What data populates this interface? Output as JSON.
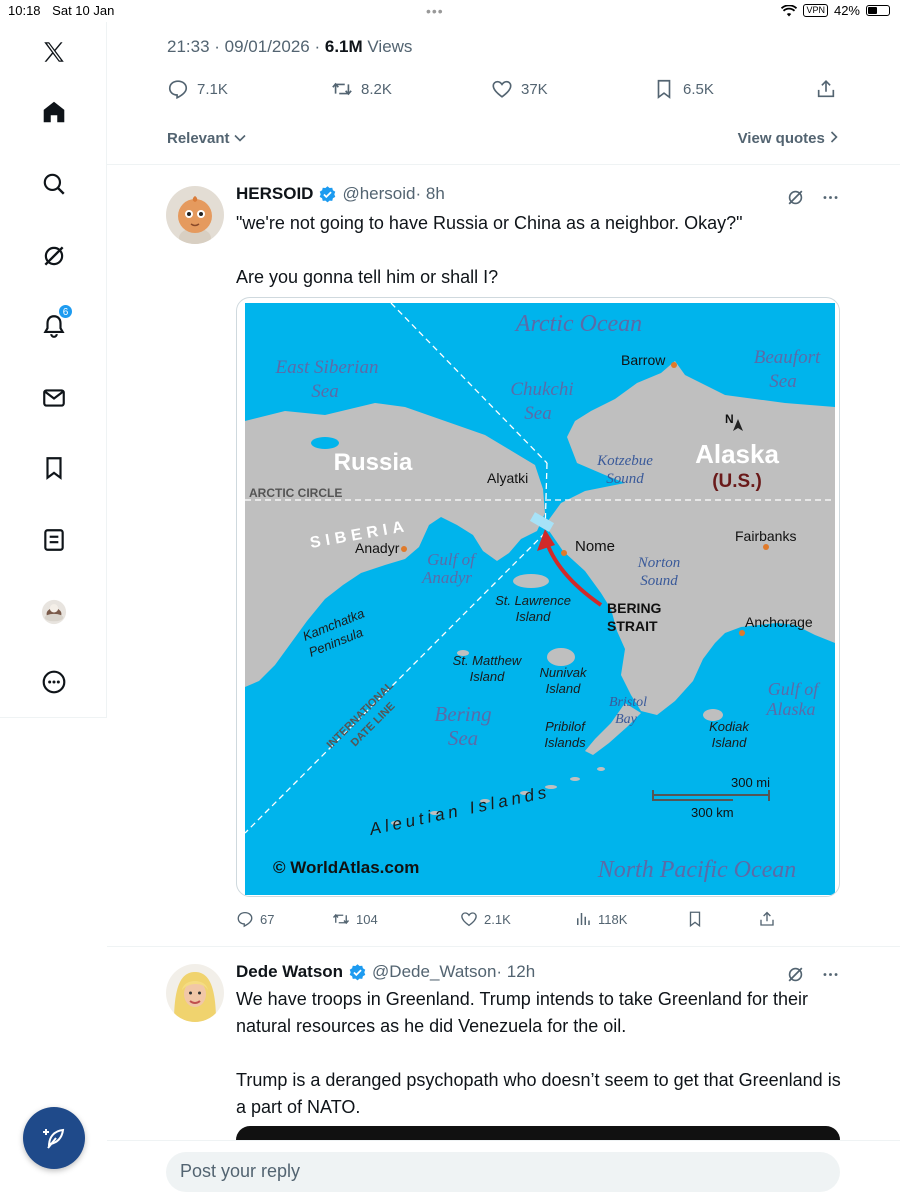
{
  "status_bar": {
    "time": "10:18",
    "date": "Sat 10 Jan",
    "vpn": "VPN",
    "battery": "42%"
  },
  "nav": {
    "notifications_badge": "6"
  },
  "post": {
    "time": "21:33 · 09/01/2026 ·",
    "views_count": "6.1M",
    "views_label": "Views",
    "replies": "7.1K",
    "reposts": "8.2K",
    "likes": "37K",
    "bookmarks": "6.5K"
  },
  "sort": {
    "relevant": "Relevant",
    "view_quotes": "View quotes"
  },
  "reply1": {
    "name": "HERSOID",
    "handle": "@hersoid",
    "age": "· 8h",
    "text1": "\"we're not going to have Russia or China as a neighbor. Okay?\"",
    "text2": "Are you gonna tell him or shall I?",
    "replies": "67",
    "reposts": "104",
    "likes": "2.1K",
    "views": "118K"
  },
  "map": {
    "arctic_ocean": "Arctic Ocean",
    "east_siberian_1": "East Siberian",
    "east_siberian_2": "Sea",
    "chukchi_1": "Chukchi",
    "chukchi_2": "Sea",
    "barrow": "Barrow",
    "beaufort_1": "Beaufort",
    "beaufort_2": "Sea",
    "north": "N",
    "russia": "Russia",
    "alaska": "Alaska",
    "us": "(U.S.)",
    "kotzebue_1": "Kotzebue",
    "kotzebue_2": "Sound",
    "alyatki": "Alyatki",
    "arctic_circle": "ARCTIC CIRCLE",
    "siberia": "SIBERIA",
    "anadyr": "Anadyr",
    "gulf_anadyr_1": "Gulf of",
    "gulf_anadyr_2": "Anadyr",
    "nome": "Nome",
    "norton_1": "Norton",
    "norton_2": "Sound",
    "fairbanks": "Fairbanks",
    "kamchatka_1": "Kamchatka",
    "kamchatka_2": "Peninsula",
    "st_lawrence_1": "St. Lawrence",
    "st_lawrence_2": "Island",
    "bering_strait_1": "BERING",
    "bering_strait_2": "STRAIT",
    "anchorage": "Anchorage",
    "date_line_1": "INTERNATIONAL",
    "date_line_2": "DATE LINE",
    "st_matthew_1": "St. Matthew",
    "st_matthew_2": "Island",
    "nunivak_1": "Nunivak",
    "nunivak_2": "Island",
    "bristol_1": "Bristol",
    "bristol_2": "Bay",
    "gulf_alaska_1": "Gulf of",
    "gulf_alaska_2": "Alaska",
    "bering_sea_1": "Bering",
    "bering_sea_2": "Sea",
    "pribilof_1": "Pribilof",
    "pribilof_2": "Islands",
    "kodiak_1": "Kodiak",
    "kodiak_2": "Island",
    "scale_mi": "300 mi",
    "scale_km": "300 km",
    "aleutian": "Aleutian Islands",
    "credit": "© WorldAtlas.com",
    "north_pacific": "North Pacific Ocean"
  },
  "reply2": {
    "name": "Dede Watson",
    "handle": "@Dede_Watson",
    "age": "· 12h",
    "text1": "We have troops in Greenland. Trump intends to take Greenland for their natural resources as he did Venezuela for the oil.",
    "text2": "Trump is a deranged psychopath who doesn’t seem to get that Greenland is a part of NATO."
  },
  "reply_bar": {
    "placeholder": "Post your reply"
  }
}
